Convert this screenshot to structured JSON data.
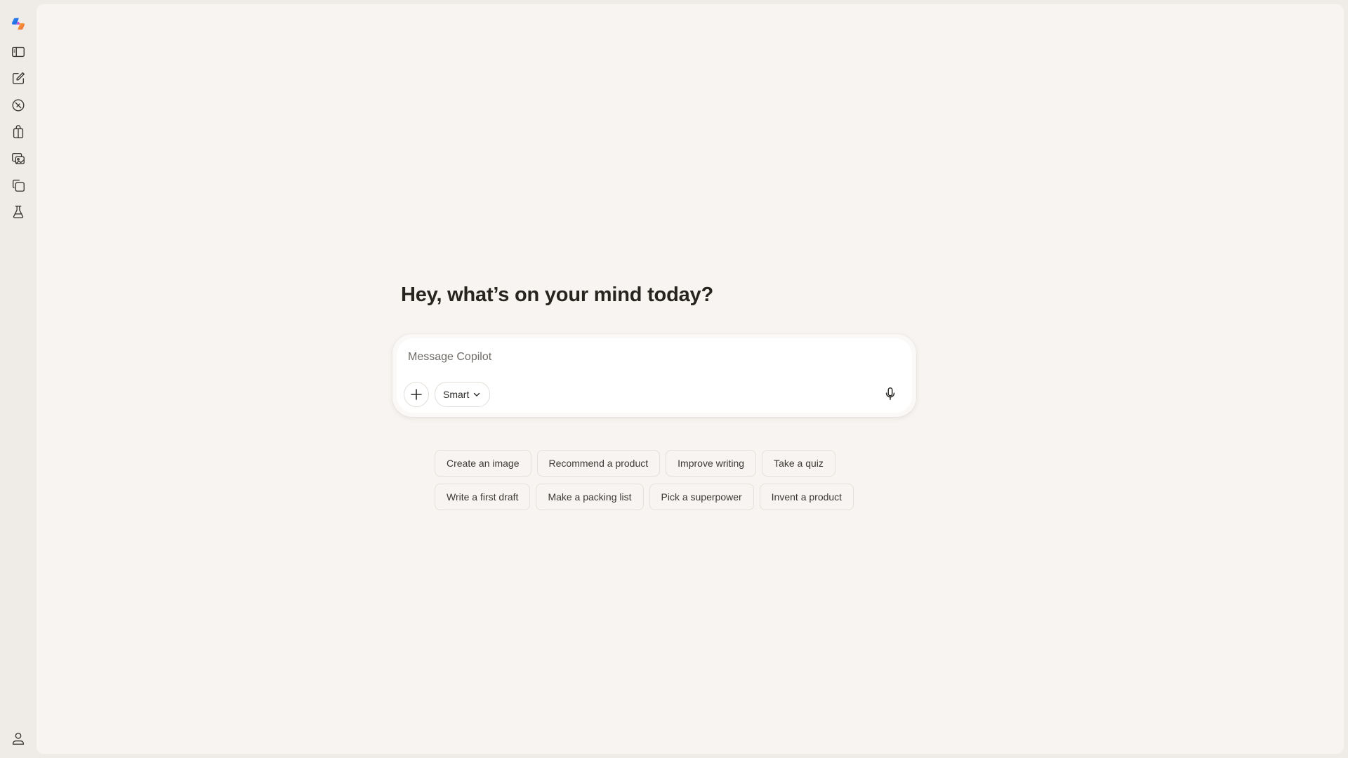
{
  "sidebar": {
    "items": [
      {
        "name": "copilot-logo",
        "icon": "copilot-logo-icon"
      },
      {
        "name": "toggle-sidebar",
        "icon": "sidebar-panel-icon"
      },
      {
        "name": "new-chat",
        "icon": "compose-icon"
      },
      {
        "name": "discover",
        "icon": "compass-icon"
      },
      {
        "name": "shopping",
        "icon": "shopping-bag-icon"
      },
      {
        "name": "imagine",
        "icon": "image-gallery-icon"
      },
      {
        "name": "pages",
        "icon": "pages-icon"
      },
      {
        "name": "labs",
        "icon": "flask-icon"
      }
    ],
    "account_icon": "user-icon"
  },
  "main": {
    "greeting": "Hey, what’s on your mind today?",
    "composer": {
      "placeholder": "Message Copilot",
      "value": "",
      "mode_label": "Smart",
      "attach_icon": "plus-icon",
      "mic_icon": "microphone-icon"
    },
    "suggestions": {
      "row1": [
        "Create an image",
        "Recommend a product",
        "Improve writing",
        "Take a quiz"
      ],
      "row2": [
        "Write a first draft",
        "Make a packing list",
        "Pick a superpower",
        "Invent a product"
      ]
    }
  },
  "colors": {
    "page_background": "#f8f4f1",
    "rail_background": "#efebe7",
    "composer_background": "#ffffff",
    "text": "#2b2a28"
  }
}
